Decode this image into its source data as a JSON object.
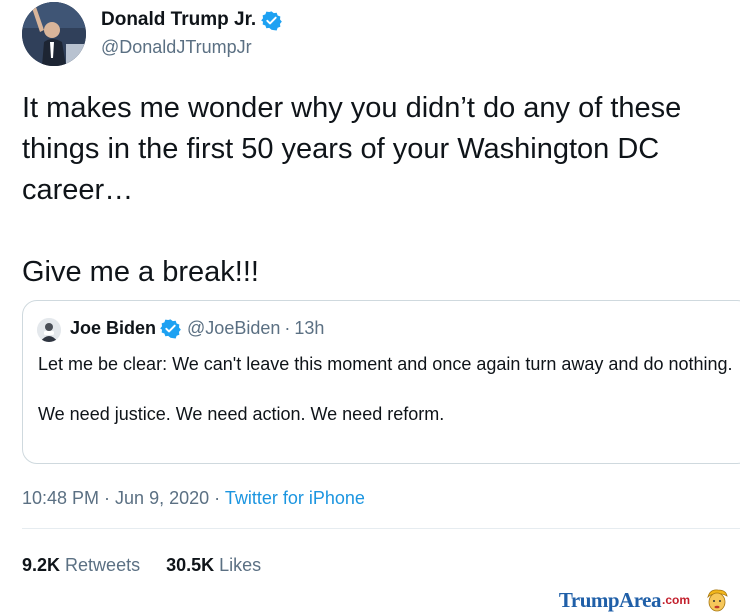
{
  "author": {
    "name": "Donald Trump Jr.",
    "handle": "@DonaldJTrumpJr",
    "verified_icon": "verified-badge-icon"
  },
  "tweet": {
    "paragraphs": [
      "It makes me wonder why you didn’t do any of these things in the first 50 years of your Washington DC career…",
      "Give me a break!!!"
    ]
  },
  "quoted": {
    "name": "Joe Biden",
    "handle": "@JoeBiden",
    "separator": "·",
    "time": "13h",
    "paragraphs": [
      "Let me be clear: We can't leave this moment and once again turn away and do nothing.",
      "We need justice. We need action. We need reform."
    ]
  },
  "meta": {
    "timestamp": "10:48 PM · Jun 9, 2020",
    "separator": "·",
    "source": "Twitter for iPhone"
  },
  "stats": {
    "retweets_count": "9.2K",
    "retweets_label": "Retweets",
    "likes_count": "30.5K",
    "likes_label": "Likes"
  },
  "watermark": {
    "brand": "TrumpArea",
    "suffix": ".com"
  },
  "colors": {
    "verified_blue": "#1da1f2",
    "link_blue": "#1b95e0",
    "secondary_text": "#5b7083",
    "watermark_blue": "#1f5fa8",
    "watermark_red": "#c21f2c"
  }
}
